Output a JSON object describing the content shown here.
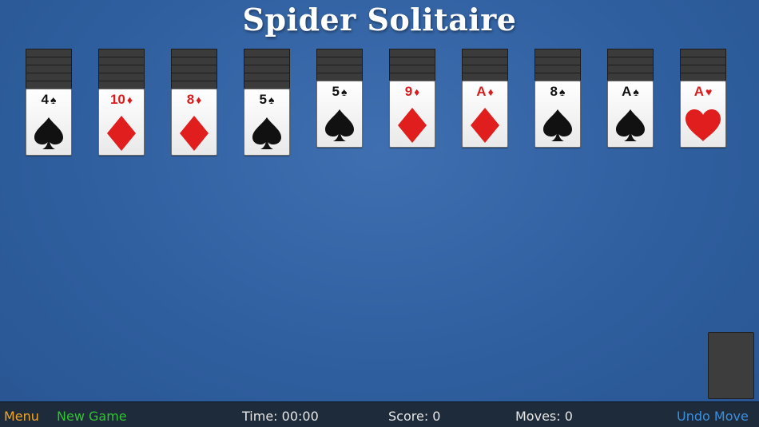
{
  "title": "Spider Solitaire",
  "colors": {
    "red": "#d81d1d",
    "black": "#111111",
    "menu": "#f0a62a",
    "new_game": "#33c233",
    "info": "#e6e6e6",
    "undo": "#3b8fe0"
  },
  "columns": [
    {
      "facedown": 5,
      "rank": "4",
      "suit": "spade"
    },
    {
      "facedown": 5,
      "rank": "10",
      "suit": "diamond"
    },
    {
      "facedown": 5,
      "rank": "8",
      "suit": "diamond"
    },
    {
      "facedown": 5,
      "rank": "5",
      "suit": "spade"
    },
    {
      "facedown": 4,
      "rank": "5",
      "suit": "spade"
    },
    {
      "facedown": 4,
      "rank": "9",
      "suit": "diamond"
    },
    {
      "facedown": 4,
      "rank": "A",
      "suit": "diamond"
    },
    {
      "facedown": 4,
      "rank": "8",
      "suit": "spade"
    },
    {
      "facedown": 4,
      "rank": "A",
      "suit": "spade"
    },
    {
      "facedown": 4,
      "rank": "A",
      "suit": "heart"
    }
  ],
  "toolbar": {
    "menu": "Menu",
    "new_game": "New Game",
    "time": "Time: 00:00",
    "score": "Score: 0",
    "moves": "Moves: 0",
    "undo": "Undo Move"
  }
}
